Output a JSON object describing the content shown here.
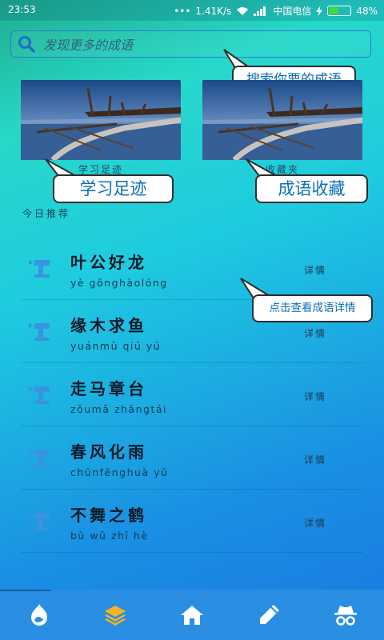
{
  "status_bar": {
    "time": "23:53",
    "dots": "•••",
    "speed": "1.41K/s",
    "carrier": "中国电信",
    "battery": "48%"
  },
  "search": {
    "placeholder": "发现更多的成语"
  },
  "callouts": {
    "search_hint": "搜索你要的成语",
    "history_hint": "学习足迹",
    "favorites_hint": "成语收藏",
    "detail_hint": "点击查看成语详情"
  },
  "cards": [
    {
      "label": "学习足迹"
    },
    {
      "label": "收藏夹"
    }
  ],
  "section_title": "今日推荐",
  "idioms": [
    {
      "name": "叶公好龙",
      "pinyin": "yè gōnghàolóng",
      "action": "详情"
    },
    {
      "name": "缘木求鱼",
      "pinyin": "yuánmù qiú yú",
      "action": "详情"
    },
    {
      "name": "走马章台",
      "pinyin": "zǒumǎ zhāngtái",
      "action": "详情"
    },
    {
      "name": "春风化雨",
      "pinyin": "chūnfēnghuà yǔ",
      "action": "详情"
    },
    {
      "name": "不舞之鹤",
      "pinyin": "bù wǔ zhī hè",
      "action": "详情"
    }
  ],
  "nav": {
    "items": [
      "drupal-icon",
      "layers-icon",
      "home-icon",
      "pencil-icon",
      "incognito-icon"
    ],
    "active_index": 1,
    "active_color": "#f5b325"
  },
  "colors": {
    "accent": "#2a8ee2",
    "bubble_text": "#0d6fb8"
  }
}
